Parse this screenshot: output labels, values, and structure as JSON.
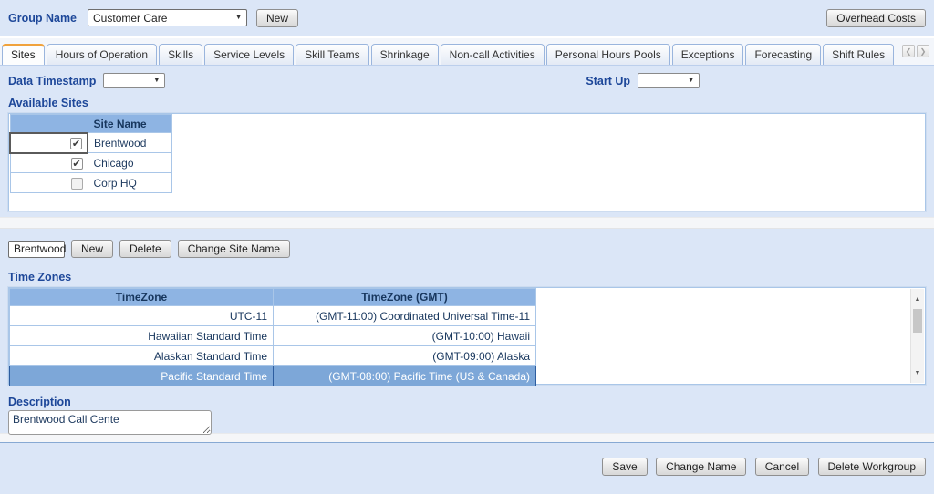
{
  "colors": {
    "section_bg": "#dbe6f7",
    "table_header_blue": "#8eb4e3",
    "selected_row_blue": "#7da7d8",
    "label_blue": "#1d4799",
    "active_tab_accent": "#f0a23c"
  },
  "icons": {
    "dropdown_arrow": "▼",
    "check": "✔",
    "scroll_left": "❮",
    "scroll_right": "❯",
    "scrollbar_up": "▲",
    "scrollbar_down": "▼"
  },
  "topbar": {
    "group_name_label": "Group Name",
    "group_name_value": "Customer Care",
    "new_button": "New",
    "overhead_costs_button": "Overhead Costs"
  },
  "tabs": {
    "items": [
      {
        "label": "Sites",
        "active": true
      },
      {
        "label": "Hours of Operation",
        "active": false
      },
      {
        "label": "Skills",
        "active": false
      },
      {
        "label": "Service Levels",
        "active": false
      },
      {
        "label": "Skill Teams",
        "active": false
      },
      {
        "label": "Shrinkage",
        "active": false
      },
      {
        "label": "Non-call Activities",
        "active": false
      },
      {
        "label": "Personal Hours Pools",
        "active": false
      },
      {
        "label": "Exceptions",
        "active": false
      },
      {
        "label": "Forecasting",
        "active": false
      },
      {
        "label": "Shift Rules",
        "active": false
      }
    ]
  },
  "filters": {
    "data_timestamp_label": "Data Timestamp",
    "data_timestamp_value": "",
    "start_up_label": "Start Up",
    "start_up_value": ""
  },
  "available_sites": {
    "title": "Available Sites",
    "columns": [
      "",
      "Site Name"
    ],
    "rows": [
      {
        "check_glyph": "✔",
        "checked": true,
        "name": "Brentwood",
        "focused": true
      },
      {
        "check_glyph": "✔",
        "checked": true,
        "name": "Chicago",
        "focused": false
      },
      {
        "check_glyph": "",
        "checked": false,
        "name": "Corp HQ",
        "focused": false
      }
    ]
  },
  "site_toolbar": {
    "site_select_value": "Brentwood",
    "new_button": "New",
    "delete_button": "Delete",
    "change_site_name_button": "Change Site Name"
  },
  "time_zones": {
    "title": "Time Zones",
    "columns": [
      "TimeZone",
      "TimeZone (GMT)"
    ],
    "rows": [
      {
        "timezone": "UTC-11",
        "gmt": "(GMT-11:00) Coordinated Universal Time-11",
        "selected": false
      },
      {
        "timezone": "Hawaiian Standard Time",
        "gmt": "(GMT-10:00) Hawaii",
        "selected": false
      },
      {
        "timezone": "Alaskan Standard Time",
        "gmt": "(GMT-09:00) Alaska",
        "selected": false
      },
      {
        "timezone": "Pacific Standard Time",
        "gmt": "(GMT-08:00) Pacific Time (US & Canada)",
        "selected": true
      }
    ]
  },
  "description": {
    "label": "Description",
    "value": "Brentwood Call Cente"
  },
  "footer": {
    "save_button": "Save",
    "change_name_button": "Change Name",
    "cancel_button": "Cancel",
    "delete_workgroup_button": "Delete Workgroup"
  }
}
